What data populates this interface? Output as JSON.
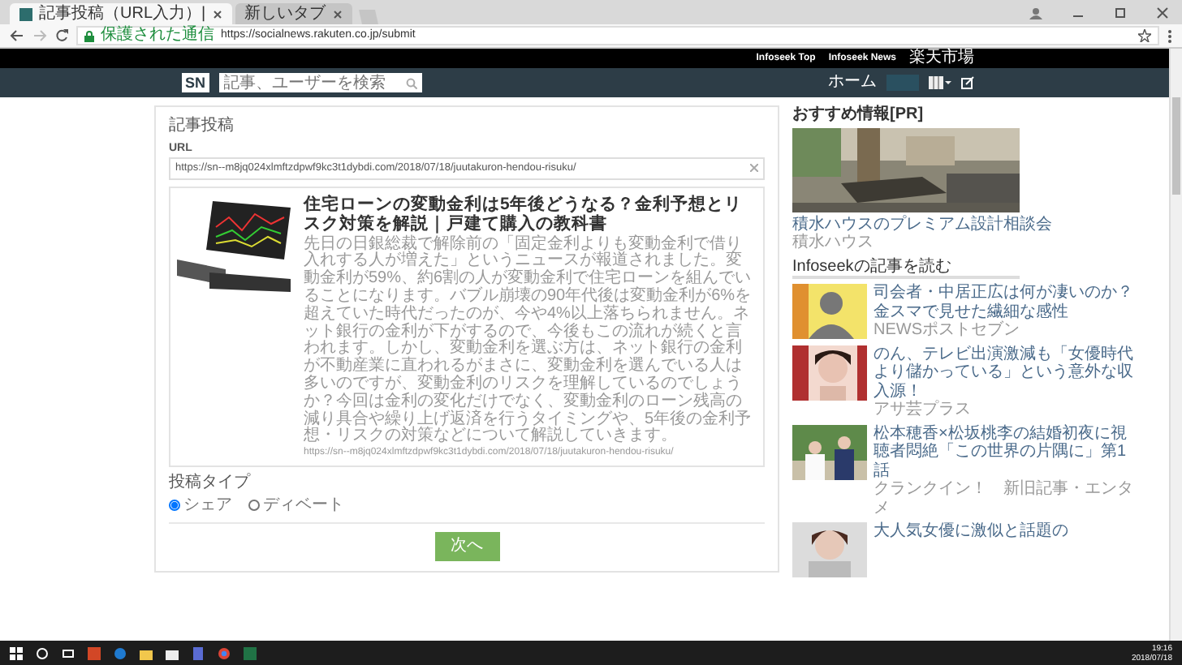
{
  "browser": {
    "tabs": [
      {
        "title": "記事投稿（URL入力）|",
        "selected": true
      },
      {
        "title": "新しいタブ",
        "selected": false
      }
    ],
    "security": "保護された通信",
    "url": "https://socialnews.rakuten.co.jp/submit"
  },
  "top_links": [
    "Infoseek Top",
    "Infoseek News",
    "楽天市場"
  ],
  "header": {
    "logo": "SN",
    "search": {
      "placeholder": "記事、ユーザーを検索"
    },
    "nav": "ホーム"
  },
  "form": {
    "title": "記事投稿",
    "url_label": "URL",
    "url_value": "https://sn--m8jq024xlmftzdpwf9kc3t1dybdi.com/2018/07/18/juutakuron-hendou-risuku/",
    "preview": {
      "title": "住宅ローンの変動金利は5年後どうなる？金利予想とリスク対策を解説｜戸建て購入の教科書",
      "description": "先日の日銀総裁で解除前の「固定金利よりも変動金利で借り入れする人が増えた」というニュースが報道されました。変動金利が59%、約6割の人が変動金利で住宅ローンを組んでいることになります。バブル崩壊の90年代後は変動金利が6%を超えていた時代だったのが、今や4%以上落ちられません。ネット銀行の金利が下がするので、今後もこの流れが続くと言われます。しかし、変動金利を選ぶ方は、ネット銀行の金利が不動産業に直われるがまさに、変動金利を選んでいる人は多いのですが、変動金利のリスクを理解しているのでしょうか？今回は金利の変化だけでなく、変動金利のローン残高の減り具合や繰り上げ返済を行うタイミングや、5年後の金利予想・リスクの対策などについて解説していきます。",
      "url": "https://sn--m8jq024xlmftzdpwf9kc3t1dybdi.com/2018/07/18/juutakuron-hendou-risuku/"
    },
    "type_label": "投稿タイプ",
    "types": [
      {
        "label": "シェア",
        "selected": true
      },
      {
        "label": "ディベート",
        "selected": false
      }
    ],
    "submit": "次へ"
  },
  "sidebar": {
    "pr_heading": "おすすめ情報[PR]",
    "pr": {
      "title": "積水ハウスのプレミアム設計相談会",
      "source": "積水ハウス"
    },
    "news_heading": "Infoseekの記事を読む",
    "news": [
      {
        "title": "司会者・中居正広は何が凄いのか？金スマで見せた繊細な感性",
        "source": "NEWSポストセブン"
      },
      {
        "title": "のん、テレビ出演激減も「女優時代より儲かっている」という意外な収入源！",
        "source": "アサ芸プラス"
      },
      {
        "title": "松本穂香×松坂桃李の結婚初夜に視聴者悶絶「この世界の片隅に」第1話",
        "source": "クランクイン！　新旧記事・エンタメ"
      },
      {
        "title": "大人気女優に激似と話題の"
      }
    ]
  },
  "taskbar": {
    "time": "19:16",
    "date": "2018/07/18"
  }
}
